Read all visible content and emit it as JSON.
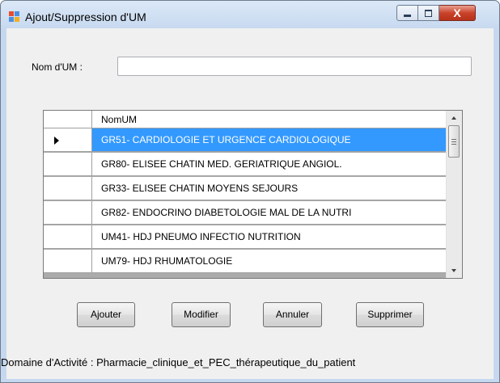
{
  "window": {
    "title": "Ajout/Suppression d'UM"
  },
  "form": {
    "nom_label": "Nom d'UM :",
    "nom_value": ""
  },
  "grid": {
    "column_header": "NomUM",
    "rows": [
      "GR51- CARDIOLOGIE ET URGENCE CARDIOLOGIQUE",
      "GR80- ELISEE CHATIN MED. GERIATRIQUE ANGIOL.",
      "GR33- ELISEE CHATIN MOYENS SEJOURS",
      "GR82- ENDOCRINO DIABETOLOGIE MAL DE LA NUTRI",
      "UM41- HDJ PNEUMO INFECTIO NUTRITION",
      "UM79- HDJ RHUMATOLOGIE"
    ],
    "selected_index": 0
  },
  "buttons": {
    "ajouter": "Ajouter",
    "modifier": "Modifier",
    "annuler": "Annuler",
    "supprimer": "Supprimer"
  },
  "status": {
    "label": "Domaine d'Activité :",
    "value": "Pharmacie_clinique_et_PEC_thérapeutique_du_patient"
  },
  "colors": {
    "selection": "#3399ff",
    "close_button": "#c9432b",
    "titlebar": "#c8daf0"
  },
  "icons": {
    "app": "app-window-icon",
    "minimize": "minimize-icon",
    "maximize": "maximize-icon",
    "close": "close-icon",
    "current_row": "row-indicator-arrow-icon"
  }
}
